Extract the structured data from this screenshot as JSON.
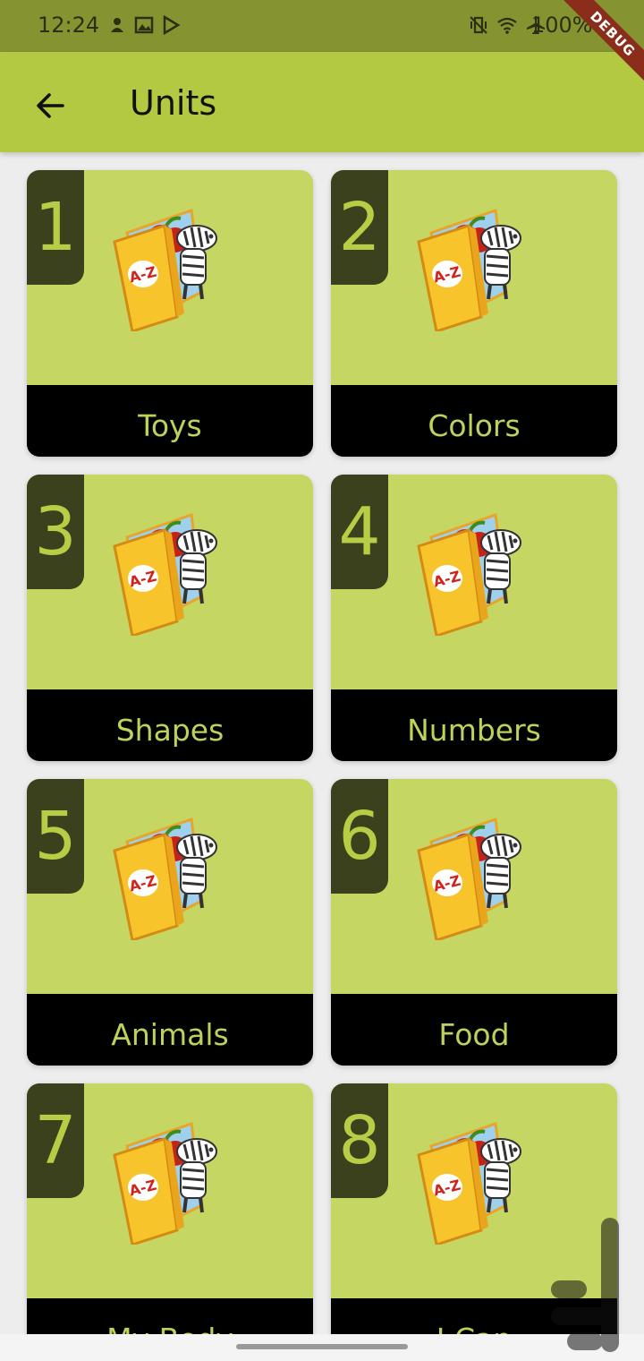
{
  "status_bar": {
    "time": "12:24",
    "battery": "100%",
    "left_icons": [
      "notification-icon",
      "image-icon",
      "play-store-icon"
    ],
    "right_icons": [
      "vibrate-icon",
      "wifi-icon",
      "airplane-icon",
      "battery-icon"
    ]
  },
  "debug_banner": "DEBUG",
  "app_bar": {
    "title": "Units",
    "back_icon": "arrow-left-icon"
  },
  "colors": {
    "status_bar": "#869331",
    "app_bar": "#b3c942",
    "card_bg": "#c6d662",
    "number_badge": "#3a411c",
    "number_text": "#b7cd46",
    "label_bg": "#000000",
    "label_text": "#bfd15a",
    "page_bg": "#ededed"
  },
  "units": [
    {
      "number": "1",
      "label": "Toys"
    },
    {
      "number": "2",
      "label": "Colors"
    },
    {
      "number": "3",
      "label": "Shapes"
    },
    {
      "number": "4",
      "label": "Numbers"
    },
    {
      "number": "5",
      "label": "Animals"
    },
    {
      "number": "6",
      "label": "Food"
    },
    {
      "number": "7",
      "label": "My Body"
    },
    {
      "number": "8",
      "label": "I Can"
    }
  ]
}
